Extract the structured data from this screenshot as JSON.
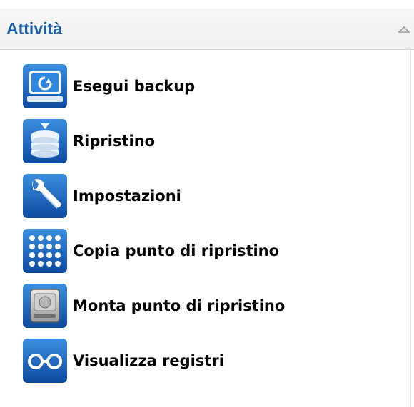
{
  "panel": {
    "title": "Attività",
    "collapse_icon": "chevron-up-outline-icon"
  },
  "tasks": [
    {
      "label": "Esegui backup",
      "icon": "backup-monitor-icon"
    },
    {
      "label": "Ripristino",
      "icon": "database-restore-icon"
    },
    {
      "label": "Impostazioni",
      "icon": "wrench-icon"
    },
    {
      "label": "Copia punto di ripristino",
      "icon": "dot-grid-icon"
    },
    {
      "label": "Monta punto di ripristino",
      "icon": "hard-drive-icon"
    },
    {
      "label": "Visualizza registri",
      "icon": "glasses-icon"
    }
  ],
  "colors": {
    "title": "#1b5fa6",
    "icon_blue": "#1f6fc7",
    "icon_dark": "#0c3f85"
  }
}
